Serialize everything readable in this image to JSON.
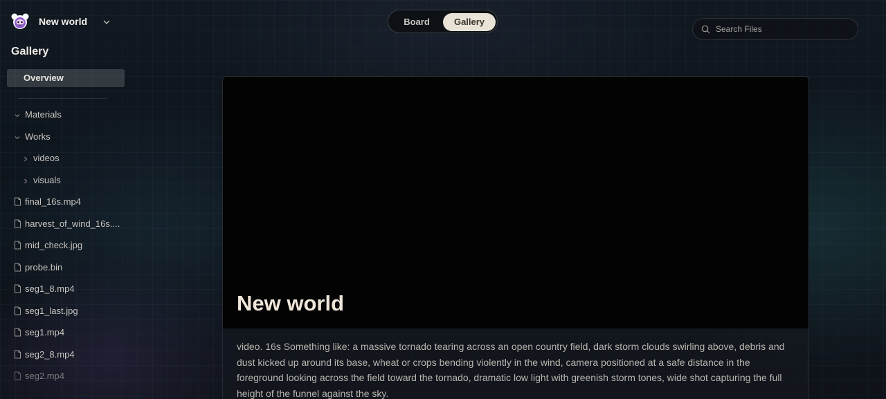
{
  "workspace": {
    "name": "New world"
  },
  "sidebar": {
    "section_title": "Gallery",
    "overview_label": "Overview",
    "folders": [
      {
        "label": "Materials",
        "expanded": true
      },
      {
        "label": "Works",
        "expanded": true
      },
      {
        "label": "videos",
        "expanded": false
      },
      {
        "label": "visuals",
        "expanded": false
      }
    ],
    "files": [
      "final_16s.mp4",
      "harvest_of_wind_16s....",
      "mid_check.jpg",
      "probe.bin",
      "seg1_8.mp4",
      "seg1_last.jpg",
      "seg1.mp4",
      "seg2_8.mp4",
      "seg2.mp4"
    ]
  },
  "view_toggle": {
    "board": "Board",
    "gallery": "Gallery",
    "active": "Gallery"
  },
  "search": {
    "placeholder": "Search Files",
    "value": ""
  },
  "card": {
    "title": "New world",
    "description": "video. 16s Something like: a massive tornado tearing across an open country field, dark storm clouds swirling above, debris and dust kicked up around its base, wheat or crops bending violently in the wind, camera positioned at a safe distance in the foreground looking across the field toward the tornado, dramatic low light with greenish storm tones, wide shot capturing the full height of the funnel against the sky."
  },
  "colors": {
    "accent": "#e9e2d6",
    "media_background": "#030303",
    "logo_purple": "#9b6ad8"
  }
}
